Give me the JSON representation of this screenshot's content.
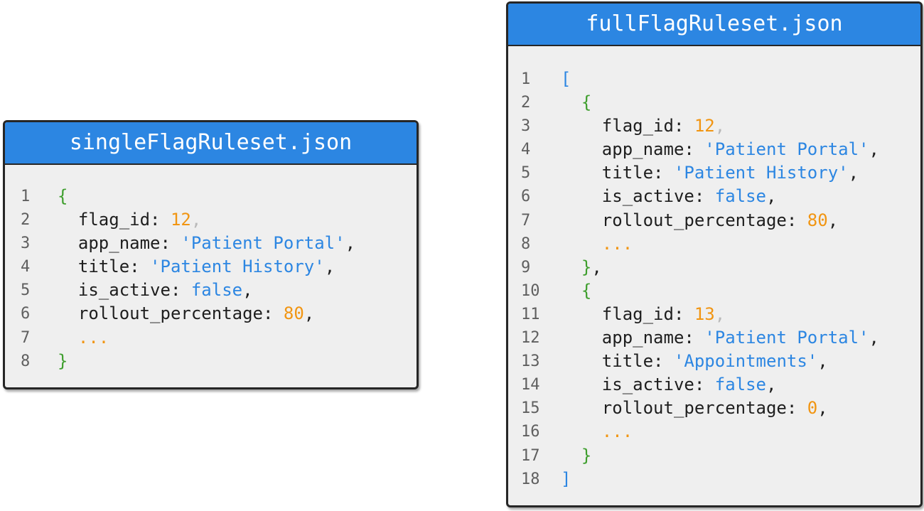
{
  "single": {
    "title": "singleFlagRuleset.json",
    "lines": [
      {
        "n": "1",
        "tokens": [
          {
            "t": "{",
            "k": "brace"
          }
        ]
      },
      {
        "n": "2",
        "tokens": [
          {
            "t": "  flag_id: ",
            "k": "key"
          },
          {
            "t": "12",
            "k": "num"
          },
          {
            "t": ",",
            "k": "punct-faint"
          }
        ]
      },
      {
        "n": "3",
        "tokens": [
          {
            "t": "  app_name: ",
            "k": "key"
          },
          {
            "t": "'Patient Portal'",
            "k": "str"
          },
          {
            "t": ",",
            "k": "punct"
          }
        ]
      },
      {
        "n": "4",
        "tokens": [
          {
            "t": "  title: ",
            "k": "key"
          },
          {
            "t": "'Patient History'",
            "k": "str"
          },
          {
            "t": ",",
            "k": "punct"
          }
        ]
      },
      {
        "n": "5",
        "tokens": [
          {
            "t": "  is_active: ",
            "k": "key"
          },
          {
            "t": "false",
            "k": "bool"
          },
          {
            "t": ",",
            "k": "punct"
          }
        ]
      },
      {
        "n": "6",
        "tokens": [
          {
            "t": "  rollout_percentage: ",
            "k": "key"
          },
          {
            "t": "80",
            "k": "num"
          },
          {
            "t": ",",
            "k": "punct"
          }
        ]
      },
      {
        "n": "7",
        "tokens": [
          {
            "t": "  ...",
            "k": "ellipsis"
          }
        ]
      },
      {
        "n": "8",
        "tokens": [
          {
            "t": "}",
            "k": "brace"
          }
        ]
      }
    ]
  },
  "full": {
    "title": "fullFlagRuleset.json",
    "lines": [
      {
        "n": "1",
        "tokens": [
          {
            "t": "[",
            "k": "bracket"
          }
        ]
      },
      {
        "n": "2",
        "tokens": [
          {
            "t": "  {",
            "k": "brace"
          }
        ]
      },
      {
        "n": "3",
        "tokens": [
          {
            "t": "    flag_id: ",
            "k": "key"
          },
          {
            "t": "12",
            "k": "num"
          },
          {
            "t": ",",
            "k": "punct-faint"
          }
        ]
      },
      {
        "n": "4",
        "tokens": [
          {
            "t": "    app_name: ",
            "k": "key"
          },
          {
            "t": "'Patient Portal'",
            "k": "str"
          },
          {
            "t": ",",
            "k": "punct"
          }
        ]
      },
      {
        "n": "5",
        "tokens": [
          {
            "t": "    title: ",
            "k": "key"
          },
          {
            "t": "'Patient History'",
            "k": "str"
          },
          {
            "t": ",",
            "k": "punct"
          }
        ]
      },
      {
        "n": "6",
        "tokens": [
          {
            "t": "    is_active: ",
            "k": "key"
          },
          {
            "t": "false",
            "k": "bool"
          },
          {
            "t": ",",
            "k": "punct"
          }
        ]
      },
      {
        "n": "7",
        "tokens": [
          {
            "t": "    rollout_percentage: ",
            "k": "key"
          },
          {
            "t": "80",
            "k": "num"
          },
          {
            "t": ",",
            "k": "punct"
          }
        ]
      },
      {
        "n": "8",
        "tokens": [
          {
            "t": "    ...",
            "k": "ellipsis"
          }
        ]
      },
      {
        "n": "9",
        "tokens": [
          {
            "t": "  }",
            "k": "brace"
          },
          {
            "t": ",",
            "k": "punct"
          }
        ]
      },
      {
        "n": "10",
        "tokens": [
          {
            "t": "  {",
            "k": "brace"
          }
        ]
      },
      {
        "n": "11",
        "tokens": [
          {
            "t": "    flag_id: ",
            "k": "key"
          },
          {
            "t": "13",
            "k": "num"
          },
          {
            "t": ",",
            "k": "punct-faint"
          }
        ]
      },
      {
        "n": "12",
        "tokens": [
          {
            "t": "    app_name: ",
            "k": "key"
          },
          {
            "t": "'Patient Portal'",
            "k": "str"
          },
          {
            "t": ",",
            "k": "punct"
          }
        ]
      },
      {
        "n": "13",
        "tokens": [
          {
            "t": "    title: ",
            "k": "key"
          },
          {
            "t": "'Appointments'",
            "k": "str"
          },
          {
            "t": ",",
            "k": "punct"
          }
        ]
      },
      {
        "n": "14",
        "tokens": [
          {
            "t": "    is_active: ",
            "k": "key"
          },
          {
            "t": "false",
            "k": "bool"
          },
          {
            "t": ",",
            "k": "punct"
          }
        ]
      },
      {
        "n": "15",
        "tokens": [
          {
            "t": "    rollout_percentage: ",
            "k": "key"
          },
          {
            "t": "0",
            "k": "num"
          },
          {
            "t": ",",
            "k": "punct"
          }
        ]
      },
      {
        "n": "16",
        "tokens": [
          {
            "t": "    ...",
            "k": "ellipsis"
          }
        ]
      },
      {
        "n": "17",
        "tokens": [
          {
            "t": "  }",
            "k": "brace"
          }
        ]
      },
      {
        "n": "18",
        "tokens": [
          {
            "t": "]",
            "k": "bracket"
          }
        ]
      }
    ]
  },
  "colors": {
    "header_bg": "#2c86e2",
    "panel_bg": "#efefef",
    "brace": "#3e9e2d",
    "bracket": "#2c86e2",
    "number": "#f19512",
    "string": "#2c86e2",
    "boolean": "#2c86e2"
  }
}
